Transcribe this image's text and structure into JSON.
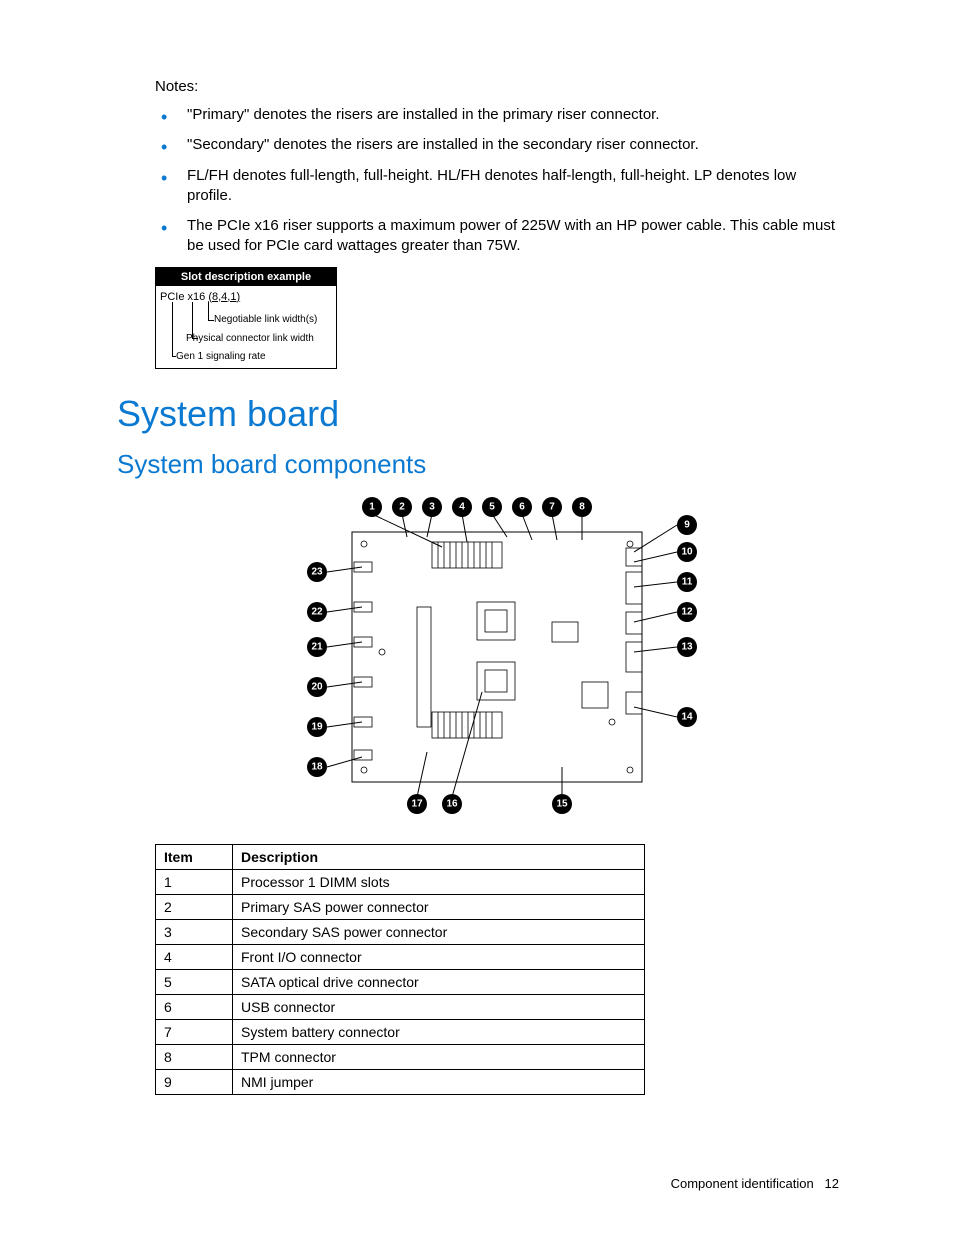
{
  "notes": {
    "heading": "Notes:",
    "items": [
      "\"Primary\" denotes the risers are installed in the primary riser connector.",
      "\"Secondary\" denotes the risers are installed in the secondary riser connector.",
      "FL/FH denotes full-length, full-height. HL/FH denotes half-length, full-height. LP denotes low profile.",
      "The PCIe x16 riser supports a maximum power of 225W with an HP power cable. This cable must be used for PCIe card wattages greater than 75W."
    ]
  },
  "slot_example": {
    "header": "Slot description example",
    "line1_a": "PCIe x16 ",
    "line1_b": "(8,4,1)",
    "negotiable": "Negotiable link width(s)",
    "physical": "Physical connector link width",
    "gen1": "Gen 1 signaling rate"
  },
  "headings": {
    "h1": "System board",
    "h2": "System board components"
  },
  "callouts": {
    "top": [
      "1",
      "2",
      "3",
      "4",
      "5",
      "6",
      "7",
      "8"
    ],
    "right": [
      "9",
      "10",
      "11",
      "12",
      "13",
      "14"
    ],
    "left": [
      "23",
      "22",
      "21",
      "20",
      "19",
      "18"
    ],
    "bottom": [
      "17",
      "16",
      "15"
    ]
  },
  "table": {
    "headers": {
      "item": "Item",
      "desc": "Description"
    },
    "rows": [
      {
        "item": "1",
        "desc": "Processor 1 DIMM slots"
      },
      {
        "item": "2",
        "desc": "Primary SAS power connector"
      },
      {
        "item": "3",
        "desc": "Secondary SAS power connector"
      },
      {
        "item": "4",
        "desc": "Front I/O connector"
      },
      {
        "item": "5",
        "desc": "SATA optical drive connector"
      },
      {
        "item": "6",
        "desc": "USB connector"
      },
      {
        "item": "7",
        "desc": "System battery connector"
      },
      {
        "item": "8",
        "desc": "TPM connector"
      },
      {
        "item": "9",
        "desc": "NMI jumper"
      }
    ]
  },
  "footer": {
    "section": "Component identification",
    "page": "12"
  }
}
